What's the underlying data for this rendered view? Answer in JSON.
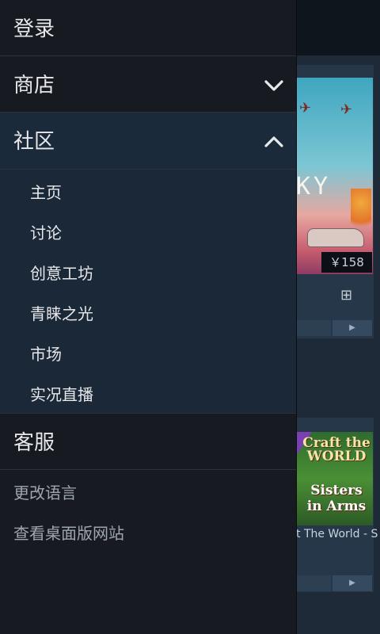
{
  "drawer": {
    "login": "登录",
    "store": "商店",
    "community": "社区",
    "community_items": [
      "主页",
      "讨论",
      "创意工坊",
      "青睐之光",
      "市场",
      "实况直播"
    ],
    "support": "客服",
    "change_language": "更改语言",
    "desktop_site": "查看桌面版网站"
  },
  "background": {
    "card1_art_text": "KY",
    "card1_price": "￥158",
    "card2_art_line1": "Craft the WORLD",
    "card2_art_line2": "Sisters in Arms",
    "card2_title": "t The World - S"
  },
  "colors": {
    "drawer_bg": "#171a21",
    "expanded_bg": "#1b2838",
    "text": "#e6e8ea"
  }
}
